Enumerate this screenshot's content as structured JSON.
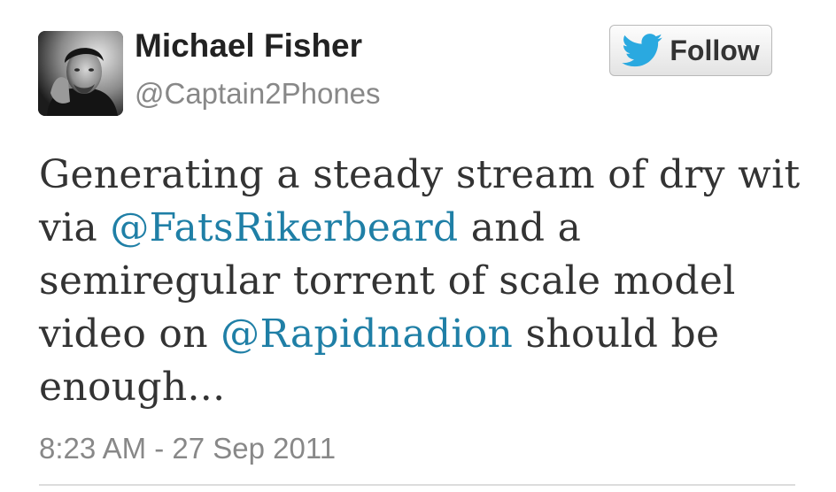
{
  "author": {
    "name": "Michael Fisher",
    "handle": "@Captain2Phones"
  },
  "follow_button": {
    "label": "Follow",
    "icon": "twitter-bird-icon",
    "icon_color": "#2aa9e0"
  },
  "tweet": {
    "parts": [
      "Generating a steady stream of dry wit via ",
      "@FatsRikerbeard",
      " and a semiregular torrent of scale model video on ",
      "@Rapidnadion",
      " should be enough..."
    ],
    "mentions": [
      "@FatsRikerbeard",
      "@Rapidnadion"
    ],
    "timestamp": "8:23 AM - 27 Sep 2011"
  },
  "colors": {
    "text": "#333333",
    "muted": "#888888",
    "link": "#1f7fa6"
  }
}
